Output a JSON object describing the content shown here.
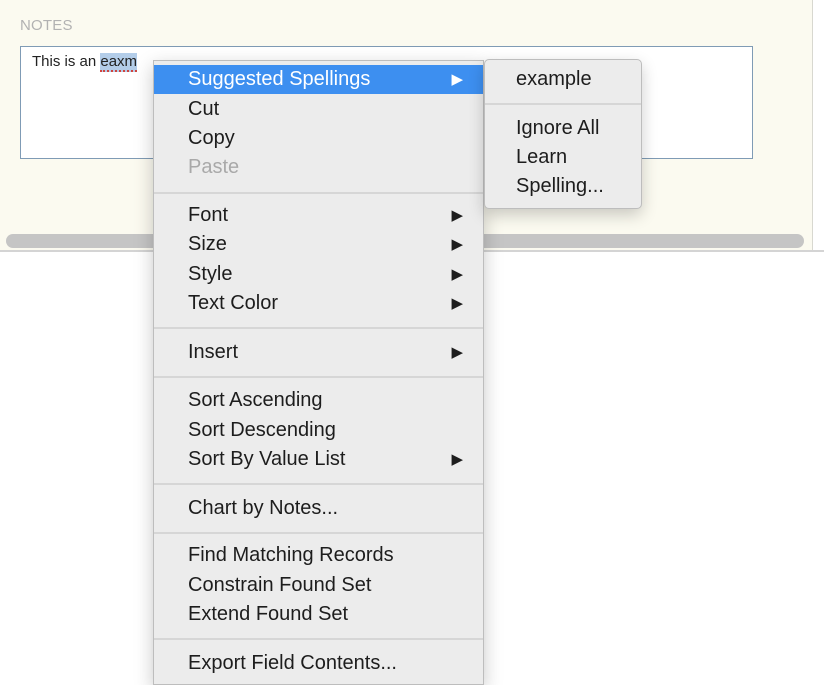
{
  "notes_field": {
    "label": "NOTES",
    "text_before": "This is an ",
    "misspelled": "eaxm",
    "text_after": ""
  },
  "context_menu": {
    "suggested_spellings": "Suggested Spellings",
    "cut": "Cut",
    "copy": "Copy",
    "paste": "Paste",
    "font": "Font",
    "size": "Size",
    "style": "Style",
    "text_color": "Text Color",
    "insert": "Insert",
    "sort_ascending": "Sort Ascending",
    "sort_descending": "Sort Descending",
    "sort_by_value_list": "Sort By Value List",
    "chart_by_notes": "Chart by Notes...",
    "find_matching_records": "Find Matching Records",
    "constrain_found_set": "Constrain Found Set",
    "extend_found_set": "Extend Found Set",
    "export_field_contents": "Export Field Contents...",
    "submenu_arrow": "▶"
  },
  "spelling_submenu": {
    "suggestion": "example",
    "ignore_all": "Ignore All",
    "learn": "Learn",
    "spelling": "Spelling..."
  },
  "colors": {
    "highlight": "#3d8ff0",
    "menu_bg": "#ececec",
    "panel_bg": "#fbfaf0"
  }
}
